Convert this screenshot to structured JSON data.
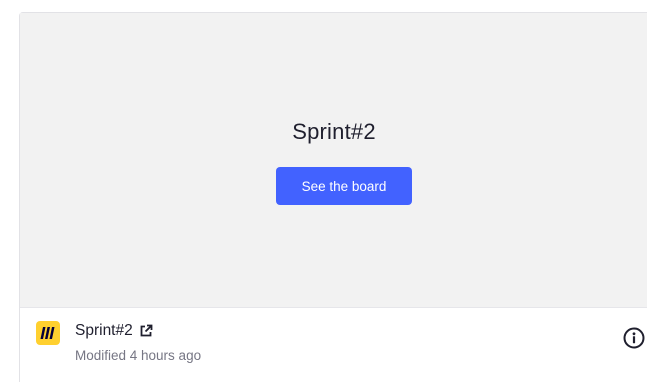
{
  "preview": {
    "title": "Sprint#2",
    "button_label": "See the board"
  },
  "footer": {
    "board_name": "Sprint#2",
    "modified": "Modified 4 hours ago",
    "app_icon": "miro-logo-icon",
    "external_icon": "external-link-icon",
    "info_icon": "info-icon"
  },
  "colors": {
    "button": "#4262ff",
    "logo_bg": "#ffd02f",
    "preview_bg": "#f2f2f2"
  }
}
